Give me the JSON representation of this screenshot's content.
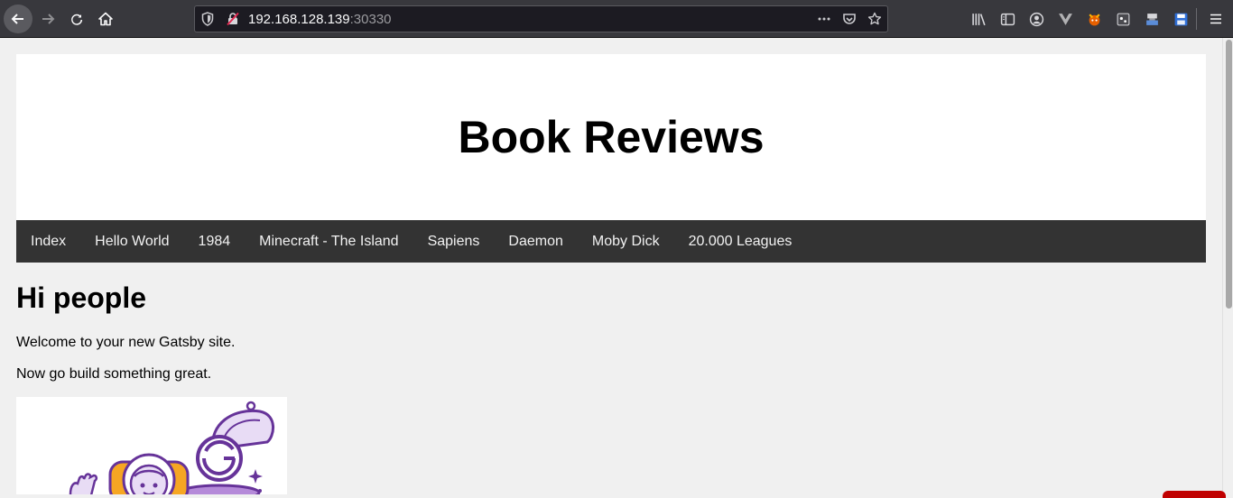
{
  "browser": {
    "url_host": "192.168.128.139",
    "url_port": ":30330"
  },
  "site": {
    "title": "Book Reviews",
    "nav": [
      {
        "label": "Index"
      },
      {
        "label": "Hello World"
      },
      {
        "label": "1984"
      },
      {
        "label": "Minecraft - The Island"
      },
      {
        "label": "Sapiens"
      },
      {
        "label": "Daemon"
      },
      {
        "label": "Moby Dick"
      },
      {
        "label": "20.000 Leagues"
      }
    ]
  },
  "main": {
    "heading": "Hi people",
    "para1": "Welcome to your new Gatsby site.",
    "para2": "Now go build something great."
  },
  "colors": {
    "nav_bg": "#333333",
    "gatsby_purple": "#663399",
    "accent_orange": "#f6a623"
  }
}
